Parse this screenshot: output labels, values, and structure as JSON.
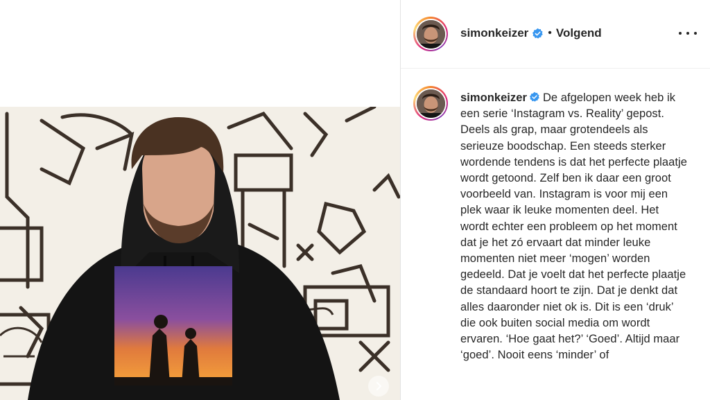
{
  "post": {
    "username": "simonkeizer",
    "verified_icon": "verified-badge-icon",
    "separator": "•",
    "follow_status": "Volgend",
    "more_icon": "more-options-icon",
    "caption": "De afgelopen week heb ik een serie ‘Instagram vs. Reality’ gepost. Deels als grap, maar grotendeels als serieuze boodschap. Een steeds sterker wordende tendens is dat het perfecte plaatje wordt getoond. Zelf ben ik daar een groot voorbeeld van. Instagram is voor mij een plek waar ik leuke momenten deel. Het wordt echter een probleem op het moment dat je het zó ervaart dat minder leuke momenten niet meer ‘mogen’ worden gedeeld. Dat je voelt dat het perfecte plaatje de standaard hoort te zijn. Dat je denkt dat alles daaronder niet ok is. Dit is een ‘druk’ die ook buiten social media om wordt ervaren. ‘Hoe gaat het?’ ‘Goed’. Altijd maar ‘goed’. Nooit eens ‘minder’ of"
  },
  "media": {
    "next_icon": "chevron-right-icon"
  },
  "colors": {
    "verified_blue": "#3897f0",
    "text": "#262626",
    "divider": "#efefef"
  }
}
